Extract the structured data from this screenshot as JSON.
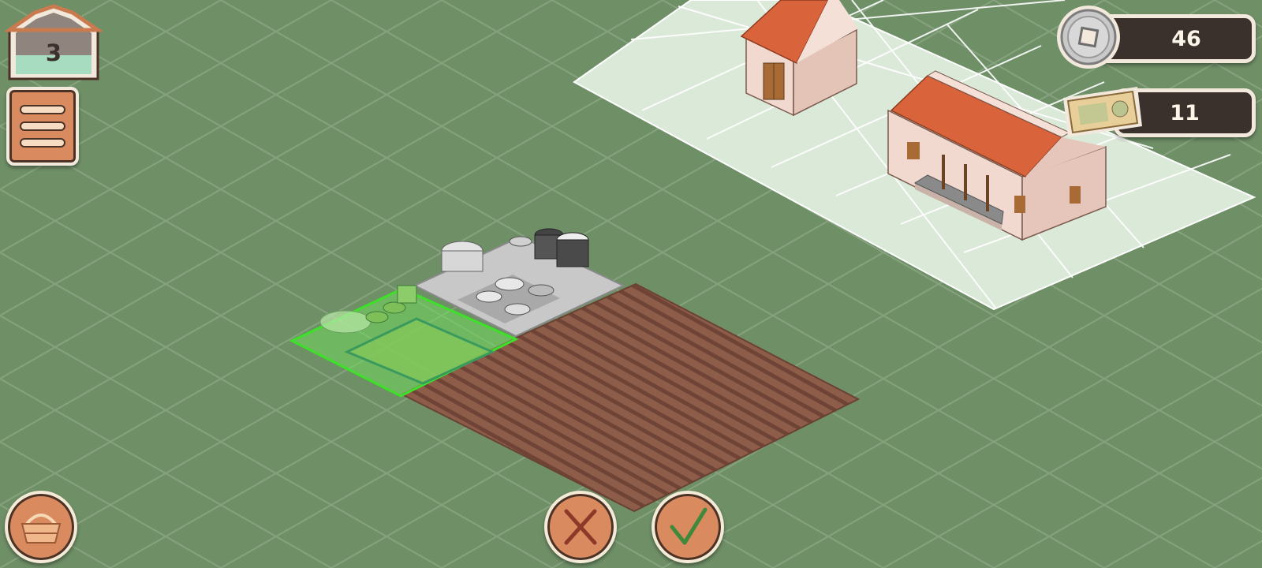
{
  "hud": {
    "level": {
      "value": "3"
    },
    "menu_button": {
      "icon": "hamburger-menu-icon"
    },
    "coins": {
      "value": "46",
      "icon": "silver-coin-icon"
    },
    "banknotes": {
      "value": "11",
      "icon": "banknote-icon"
    },
    "inventory_button": {
      "icon": "basket-icon"
    },
    "cancel_button": {
      "icon": "x-icon"
    },
    "confirm_button": {
      "icon": "checkmark-icon"
    }
  },
  "colors": {
    "grass": "#6f8f67",
    "grid_line": "#86a27e",
    "plot_tile": "#dbe9d8",
    "soil": "#8a5a48",
    "placement_ok": "#6fe05a",
    "button_fill": "#d98a5f",
    "roof_tile": "#d9643c",
    "counter_bg": "#3a302c"
  },
  "scene": {
    "objects": [
      "small-storage-house",
      "main-farmhouse",
      "outdoor-kitchen-preview",
      "garden-bed-preview",
      "plowed-field"
    ]
  }
}
